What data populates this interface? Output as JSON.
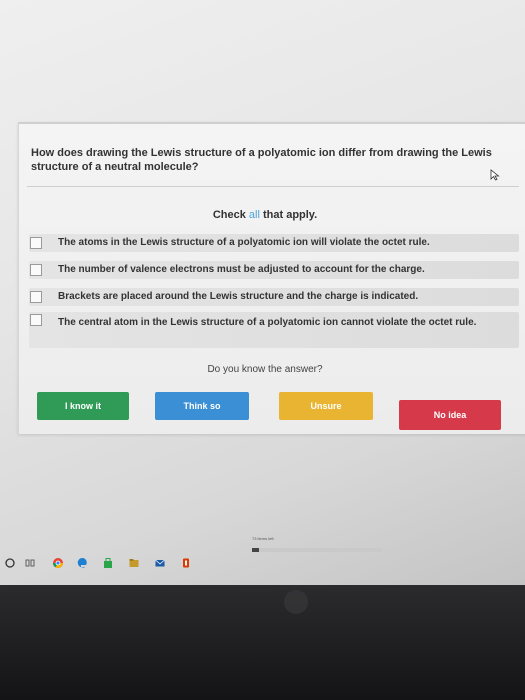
{
  "question": {
    "text": "How does drawing the Lewis structure of a polyatomic ion differ from drawing the Lewis structure of a neutral molecule?"
  },
  "instruction": {
    "prefix": "Check ",
    "accent": "all",
    "suffix": " that apply."
  },
  "options": [
    {
      "label": "The atoms in the Lewis structure of a polyatomic ion will violate the octet rule."
    },
    {
      "label": "The number of valence electrons must be adjusted to account for the charge."
    },
    {
      "label": "Brackets are placed around the Lewis structure and the charge is indicated."
    },
    {
      "label": "The central atom in the Lewis structure of a polyatomic ion cannot violate the octet rule."
    }
  ],
  "prompt": "Do you know the answer?",
  "buttons": {
    "know": "I know it",
    "think": "Think so",
    "unsure": "Unsure",
    "noidea": "No idea"
  },
  "progress": {
    "label": "73 items left",
    "fraction": 0.05
  },
  "colors": {
    "accent": "#4aa3df",
    "know": "#2f9b57",
    "think": "#3b8fd4",
    "unsure": "#e9b431",
    "noidea": "#d63a4a"
  },
  "taskbar": {
    "icons": [
      "search-circle-icon",
      "task-view-icon",
      "chrome-icon",
      "edge-icon",
      "store-icon",
      "file-explorer-icon",
      "mail-icon",
      "office-icon"
    ]
  }
}
